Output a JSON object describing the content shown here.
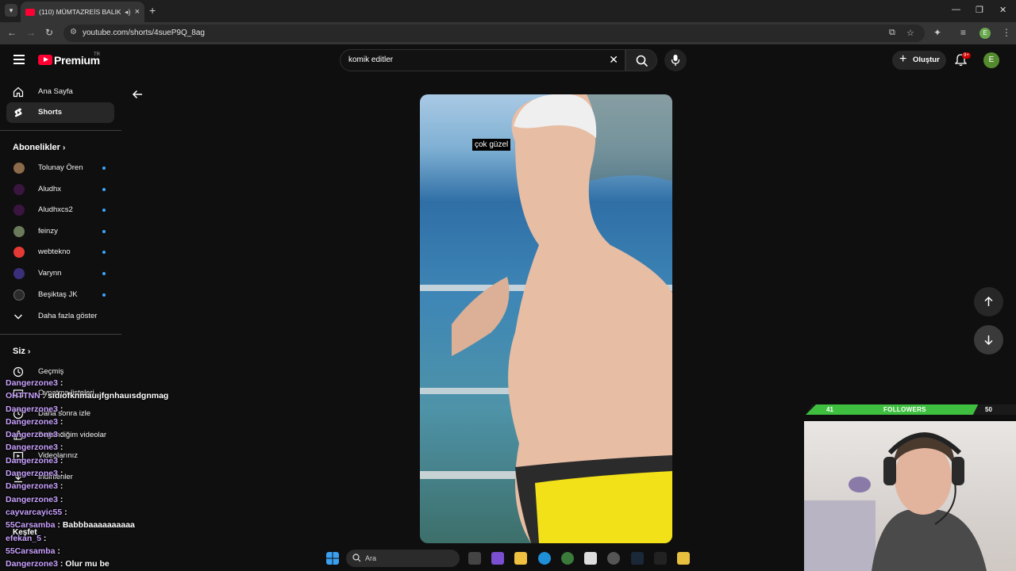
{
  "browser": {
    "tab_title": "(110) MÜMTAZREİS BALIKL",
    "url": "youtube.com/shorts/4sueP9Q_8ag"
  },
  "header": {
    "logo_text": "Premium",
    "logo_country": "TR",
    "search_value": "komik editler",
    "create_label": "Oluştur",
    "notifications_badge": "9+",
    "avatar_letter": "E"
  },
  "sidebar": {
    "main_items": [
      {
        "label": "Ana Sayfa",
        "icon": "home-icon"
      },
      {
        "label": "Shorts",
        "icon": "shorts-icon"
      }
    ],
    "subscriptions_header": "Abonelikler",
    "subscriptions": [
      {
        "label": "Tolunay Ören",
        "color": "#8b6b4a"
      },
      {
        "label": "Aludhx",
        "color": "#2a1030"
      },
      {
        "label": "Aludhxcs2",
        "color": "#2a1030"
      },
      {
        "label": "feinzy",
        "color": "#6a7a5a"
      },
      {
        "label": "webtekno",
        "color": "#e53935"
      },
      {
        "label": "Varynn",
        "color": "#3a2f7a"
      },
      {
        "label": "Beşiktaş JK",
        "color": "#222222"
      }
    ],
    "show_more": "Daha fazla göster",
    "you_header": "Siz",
    "you_items": [
      "Geçmiş",
      "Oynatma listeleri",
      "Daha sonra izle",
      "Beğendiğim videolar",
      "Videolarınız",
      "İndirilenler"
    ],
    "explore_header": "Keşfet"
  },
  "video": {
    "caption": "çok güzel"
  },
  "followers": {
    "current": "41",
    "label": "FOLLOWERS",
    "goal": "50",
    "progress": 0.82
  },
  "chat": [
    {
      "user": "Dangerzone3",
      "msg": ""
    },
    {
      "user": "OHTTNN",
      "msg": "sıdıofknmauıjfgnhauısdgnmag"
    },
    {
      "user": "Dangerzone3",
      "msg": ""
    },
    {
      "user": "Dangerzone3",
      "msg": ""
    },
    {
      "user": "Dangerzone3",
      "msg": ""
    },
    {
      "user": "Dangerzone3",
      "msg": ""
    },
    {
      "user": "Dangerzone3",
      "msg": ""
    },
    {
      "user": "Dangerzone3",
      "msg": ""
    },
    {
      "user": "Dangerzone3",
      "msg": ""
    },
    {
      "user": "Dangerzone3",
      "msg": ""
    },
    {
      "user": "cayvarcayic55",
      "msg": ""
    },
    {
      "user": "55Carsamba",
      "msg": "Babbbaaaaaaaaaa"
    },
    {
      "user": "efekan_5",
      "msg": ""
    },
    {
      "user": "55Carsamba",
      "msg": ""
    },
    {
      "user": "Dangerzone3",
      "msg": "Olur mu be"
    }
  ],
  "taskbar": {
    "search_placeholder": "Ara"
  }
}
